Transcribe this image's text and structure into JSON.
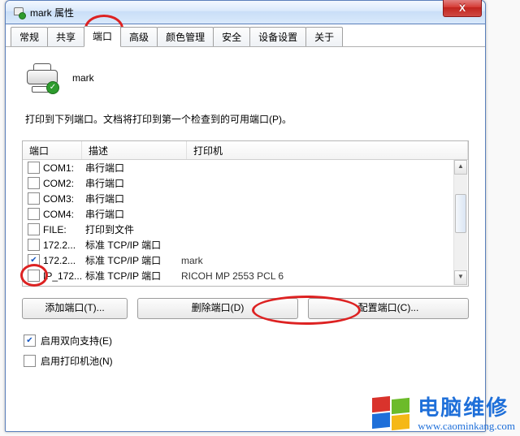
{
  "window": {
    "title": "mark 属性",
    "close_glyph": "X"
  },
  "tabs": [
    {
      "label": "常规"
    },
    {
      "label": "共享"
    },
    {
      "label": "端口"
    },
    {
      "label": "高级"
    },
    {
      "label": "颜色管理"
    },
    {
      "label": "安全"
    },
    {
      "label": "设备设置"
    },
    {
      "label": "关于"
    }
  ],
  "active_tab_index": 2,
  "printer": {
    "name": "mark"
  },
  "description": "打印到下列端口。文档将打印到第一个检查到的可用端口(P)。",
  "port_table": {
    "headers": {
      "port": "端口",
      "desc": "描述",
      "printer": "打印机"
    },
    "rows": [
      {
        "checked": false,
        "port": "COM1:",
        "desc": "串行端口",
        "printer": ""
      },
      {
        "checked": false,
        "port": "COM2:",
        "desc": "串行端口",
        "printer": ""
      },
      {
        "checked": false,
        "port": "COM3:",
        "desc": "串行端口",
        "printer": ""
      },
      {
        "checked": false,
        "port": "COM4:",
        "desc": "串行端口",
        "printer": ""
      },
      {
        "checked": false,
        "port": "FILE:",
        "desc": "打印到文件",
        "printer": ""
      },
      {
        "checked": false,
        "port": "172.2...",
        "desc": "标准 TCP/IP 端口",
        "printer": ""
      },
      {
        "checked": true,
        "port": "172.2...",
        "desc": "标准 TCP/IP 端口",
        "printer": "mark"
      },
      {
        "checked": false,
        "port": "IP_172...",
        "desc": "标准 TCP/IP 端口",
        "printer": "RICOH MP 2553 PCL 6"
      }
    ]
  },
  "buttons": {
    "add": "添加端口(T)...",
    "delete": "删除端口(D)",
    "configure": "配置端口(C)..."
  },
  "options": {
    "bidi": {
      "checked": true,
      "label": "启用双向支持(E)"
    },
    "pool": {
      "checked": false,
      "label": "启用打印机池(N)"
    }
  },
  "watermark": {
    "text": "电脑维修",
    "url": "www.caominkang.com"
  }
}
